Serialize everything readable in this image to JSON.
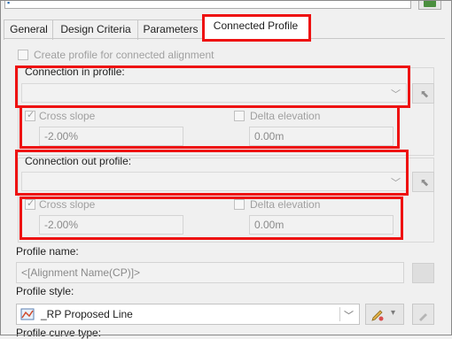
{
  "tabs": [
    {
      "label": "General"
    },
    {
      "label": "Design Criteria"
    },
    {
      "label": "Parameters"
    },
    {
      "label": "Connected Profile"
    }
  ],
  "create_profile": {
    "label": "Create profile for connected alignment",
    "checked": false
  },
  "connection_in": {
    "label": "Connection in profile:",
    "value": "",
    "cross_slope": {
      "label": "Cross slope",
      "checked": true,
      "value": "-2.00%"
    },
    "delta_elevation": {
      "label": "Delta elevation",
      "checked": false,
      "value": "0.00m"
    }
  },
  "connection_out": {
    "label": "Connection out profile:",
    "value": "",
    "cross_slope": {
      "label": "Cross slope",
      "checked": true,
      "value": "-2.00%"
    },
    "delta_elevation": {
      "label": "Delta elevation",
      "checked": false,
      "value": "0.00m"
    }
  },
  "profile_name": {
    "label": "Profile name:",
    "value": "<[Alignment Name(CP)]>"
  },
  "profile_style": {
    "label": "Profile style:",
    "value": "_RP Proposed Line"
  },
  "profile_curve_type": {
    "label": "Profile curve type:"
  },
  "icons": {
    "pick": "pick-arrow-icon",
    "style": "profile-style-icon",
    "edit": "edit-style-icon",
    "chevron": "chevron-down-icon"
  },
  "colors": {
    "highlight": "#ee1111",
    "active_tab": "#ffffff",
    "background": "#f0f0f0"
  }
}
